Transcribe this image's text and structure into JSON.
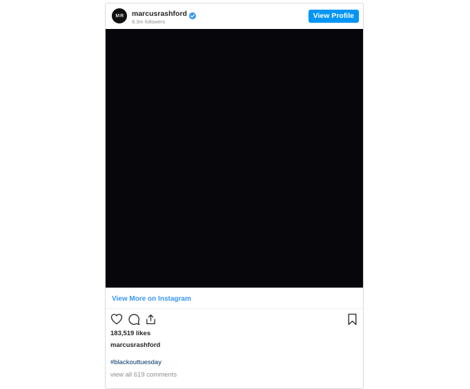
{
  "header": {
    "avatar_text": "M R",
    "username": "marcusrashford",
    "verified": true,
    "followers": "8.3m followers",
    "view_profile_label": "View Profile"
  },
  "media": {
    "background_color": "#06060b"
  },
  "links": {
    "view_more": "View More on Instagram"
  },
  "actions": {
    "icons": [
      "heart-icon",
      "comment-icon",
      "share-icon",
      "bookmark-icon"
    ]
  },
  "post": {
    "likes": "183,519 likes",
    "caption_user": "marcusrashford",
    "hashtag": "#blackouttuesday",
    "comments_link": "view all 619 comments"
  },
  "colors": {
    "accent": "#0095f6",
    "link": "#3897f0",
    "verified": "#3897f0",
    "text": "#262626",
    "muted": "#8e8e8e",
    "hashtag": "#003569"
  }
}
